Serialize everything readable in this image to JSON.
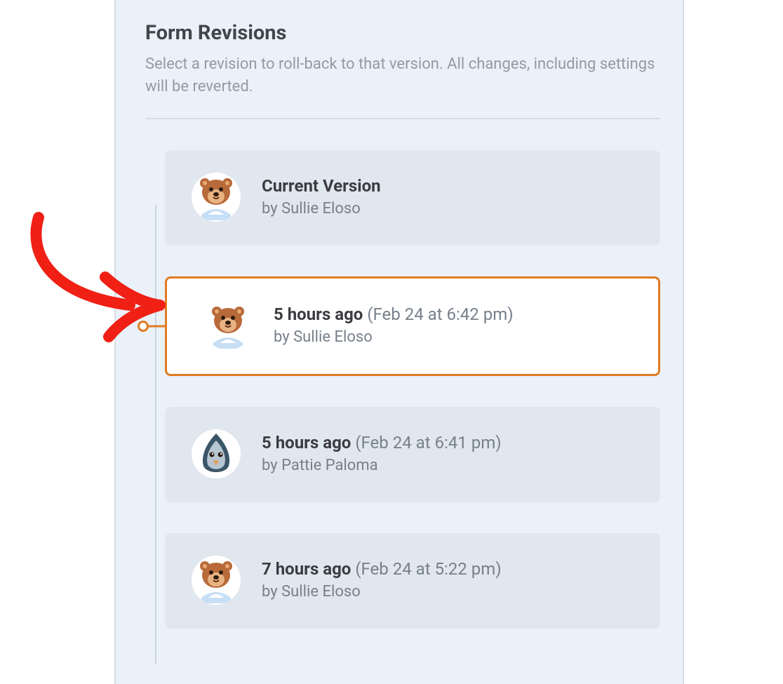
{
  "header": {
    "title": "Form Revisions",
    "description": "Select a revision to roll-back to that version. All changes, including settings will be reverted."
  },
  "revisions": [
    {
      "title": "Current Version",
      "timestamp": "",
      "by_prefix": "by ",
      "author": "Sullie Eloso",
      "avatar_type": "bear",
      "selected": false
    },
    {
      "title": "5 hours ago",
      "timestamp": "(Feb 24 at 6:42 pm)",
      "by_prefix": "by ",
      "author": "Sullie Eloso",
      "avatar_type": "bear",
      "selected": true
    },
    {
      "title": "5 hours ago",
      "timestamp": "(Feb 24 at 6:41 pm)",
      "by_prefix": "by ",
      "author": "Pattie Paloma",
      "avatar_type": "bird",
      "selected": false
    },
    {
      "title": "7 hours ago",
      "timestamp": "(Feb 24 at 5:22 pm)",
      "by_prefix": "by ",
      "author": "Sullie Eloso",
      "avatar_type": "bear",
      "selected": false
    }
  ],
  "annotation": {
    "type": "red-arrow",
    "color": "#f02015"
  }
}
